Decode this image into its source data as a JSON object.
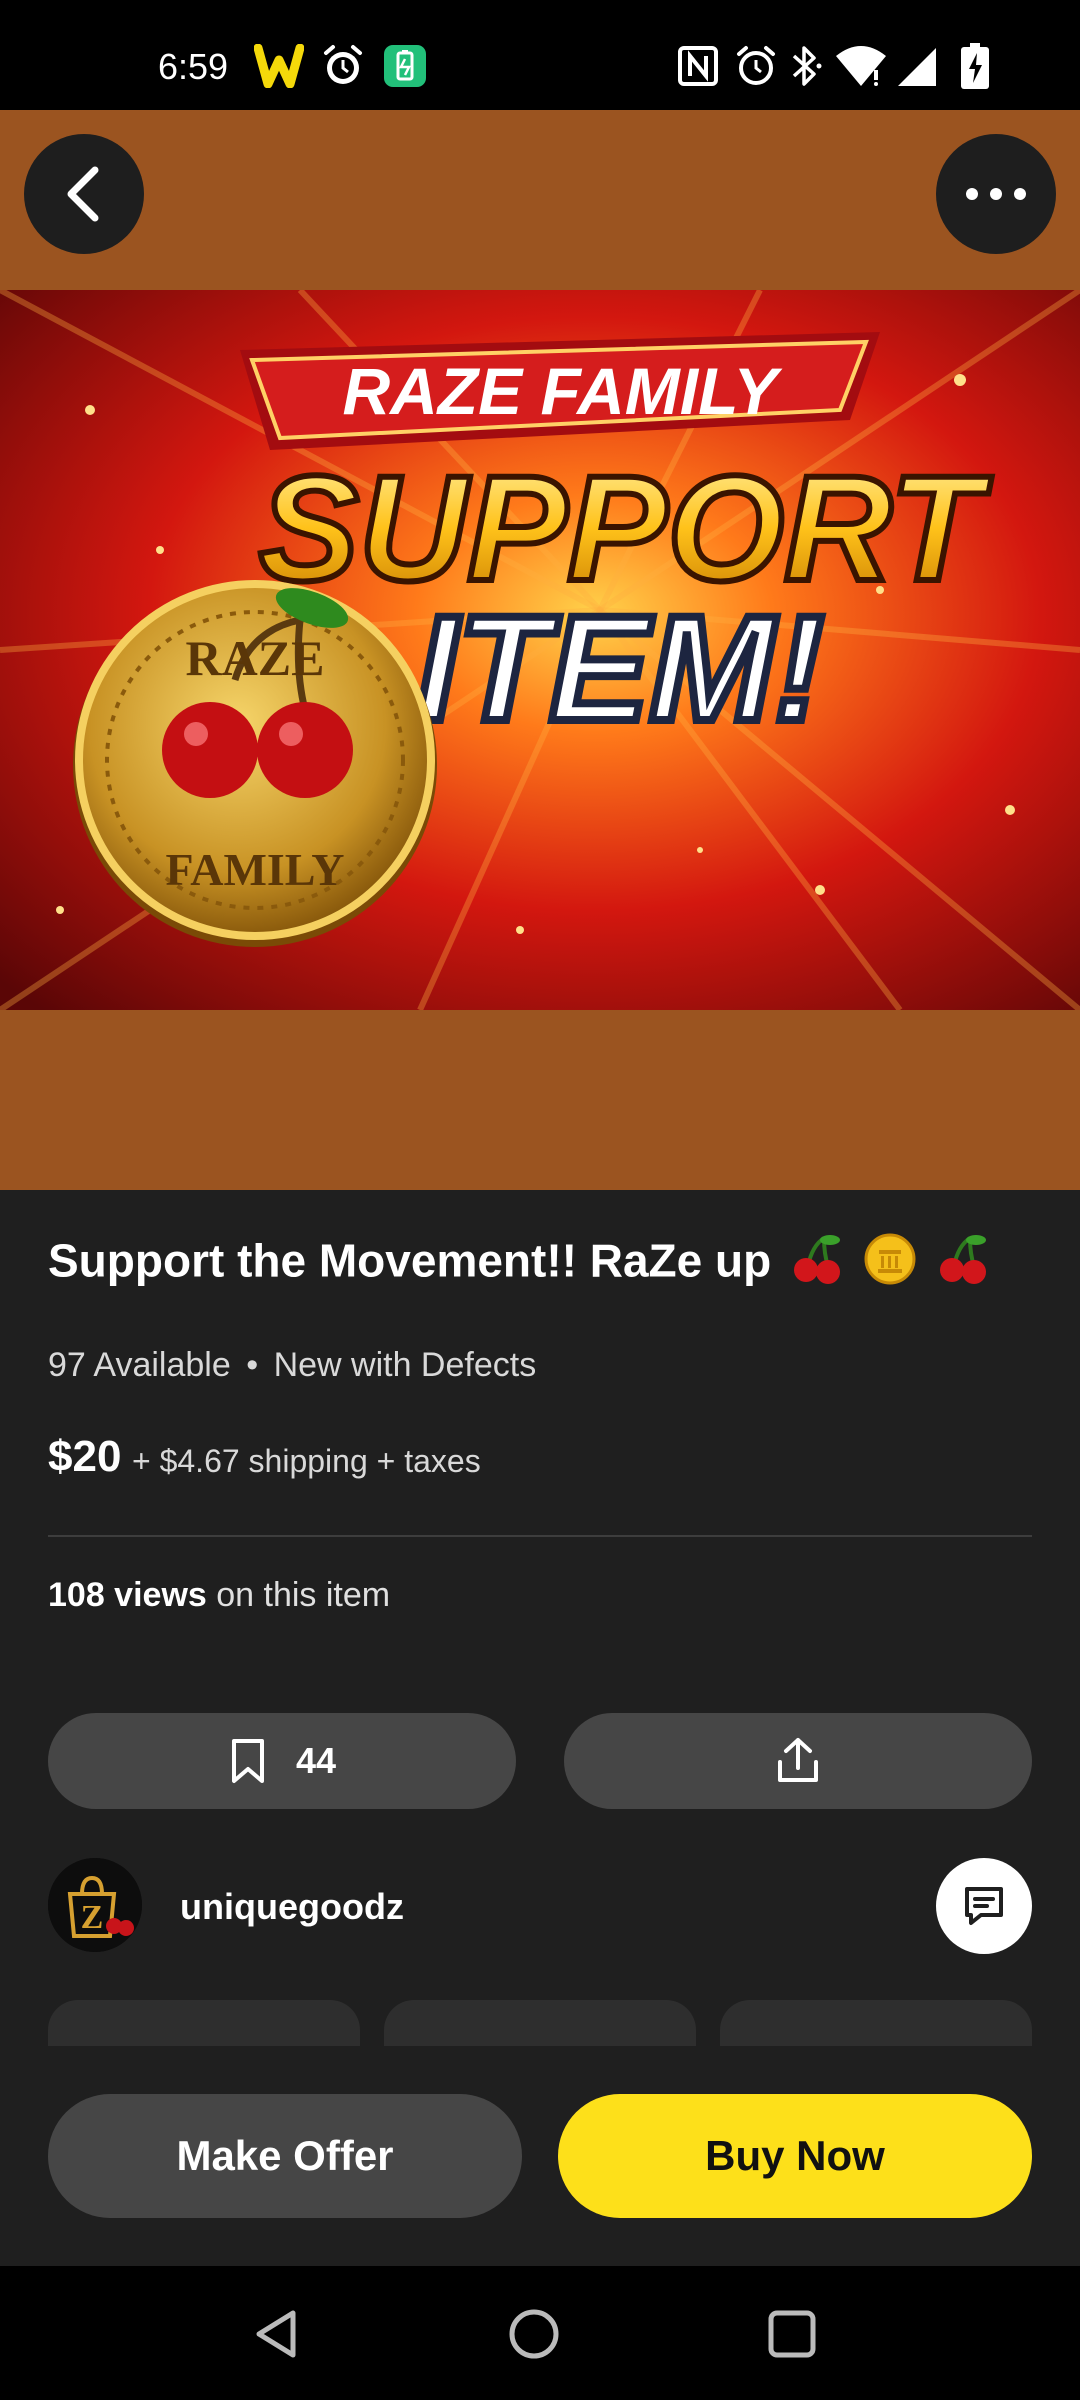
{
  "status_bar": {
    "time": "6:59",
    "left_icons": [
      "w-app-icon",
      "alarm-icon",
      "battery-saver-icon"
    ],
    "right_icons": [
      "nfc-icon",
      "alarm-icon",
      "bluetooth-icon",
      "wifi-icon",
      "signal-icon",
      "battery-charging-icon"
    ]
  },
  "hero": {
    "banner_text": "RAZE FAMILY",
    "headline_1": "SUPPORT",
    "headline_2": "ITEM!",
    "coin_top": "RAZE",
    "coin_bottom": "FAMILY",
    "back_icon": "chevron-left-icon",
    "more_icon": "more-horizontal-icon"
  },
  "listing": {
    "title": "Support the Movement!! RaZe up",
    "title_emoji": [
      "cherries",
      "coin",
      "cherries"
    ],
    "availability": "97 Available",
    "separator": "•",
    "condition": "New with Defects",
    "price": "$20",
    "price_extra": "+ $4.67 shipping + taxes",
    "views_count": "108 views",
    "views_suffix": "on this item"
  },
  "actions": {
    "bookmark_count": "44",
    "bookmark_icon": "bookmark-icon",
    "share_icon": "share-icon"
  },
  "seller": {
    "name": "uniquegoodz",
    "avatar_letter": "Z",
    "chat_icon": "chat-icon"
  },
  "buttons": {
    "make_offer": "Make Offer",
    "buy_now": "Buy Now"
  },
  "nav": {
    "icons": [
      "back-triangle-icon",
      "home-circle-icon",
      "recents-square-icon"
    ]
  },
  "colors": {
    "accent": "#fde01a",
    "background": "#1f1f1f",
    "pill": "#464646",
    "hero_bg": "#9b5420"
  }
}
